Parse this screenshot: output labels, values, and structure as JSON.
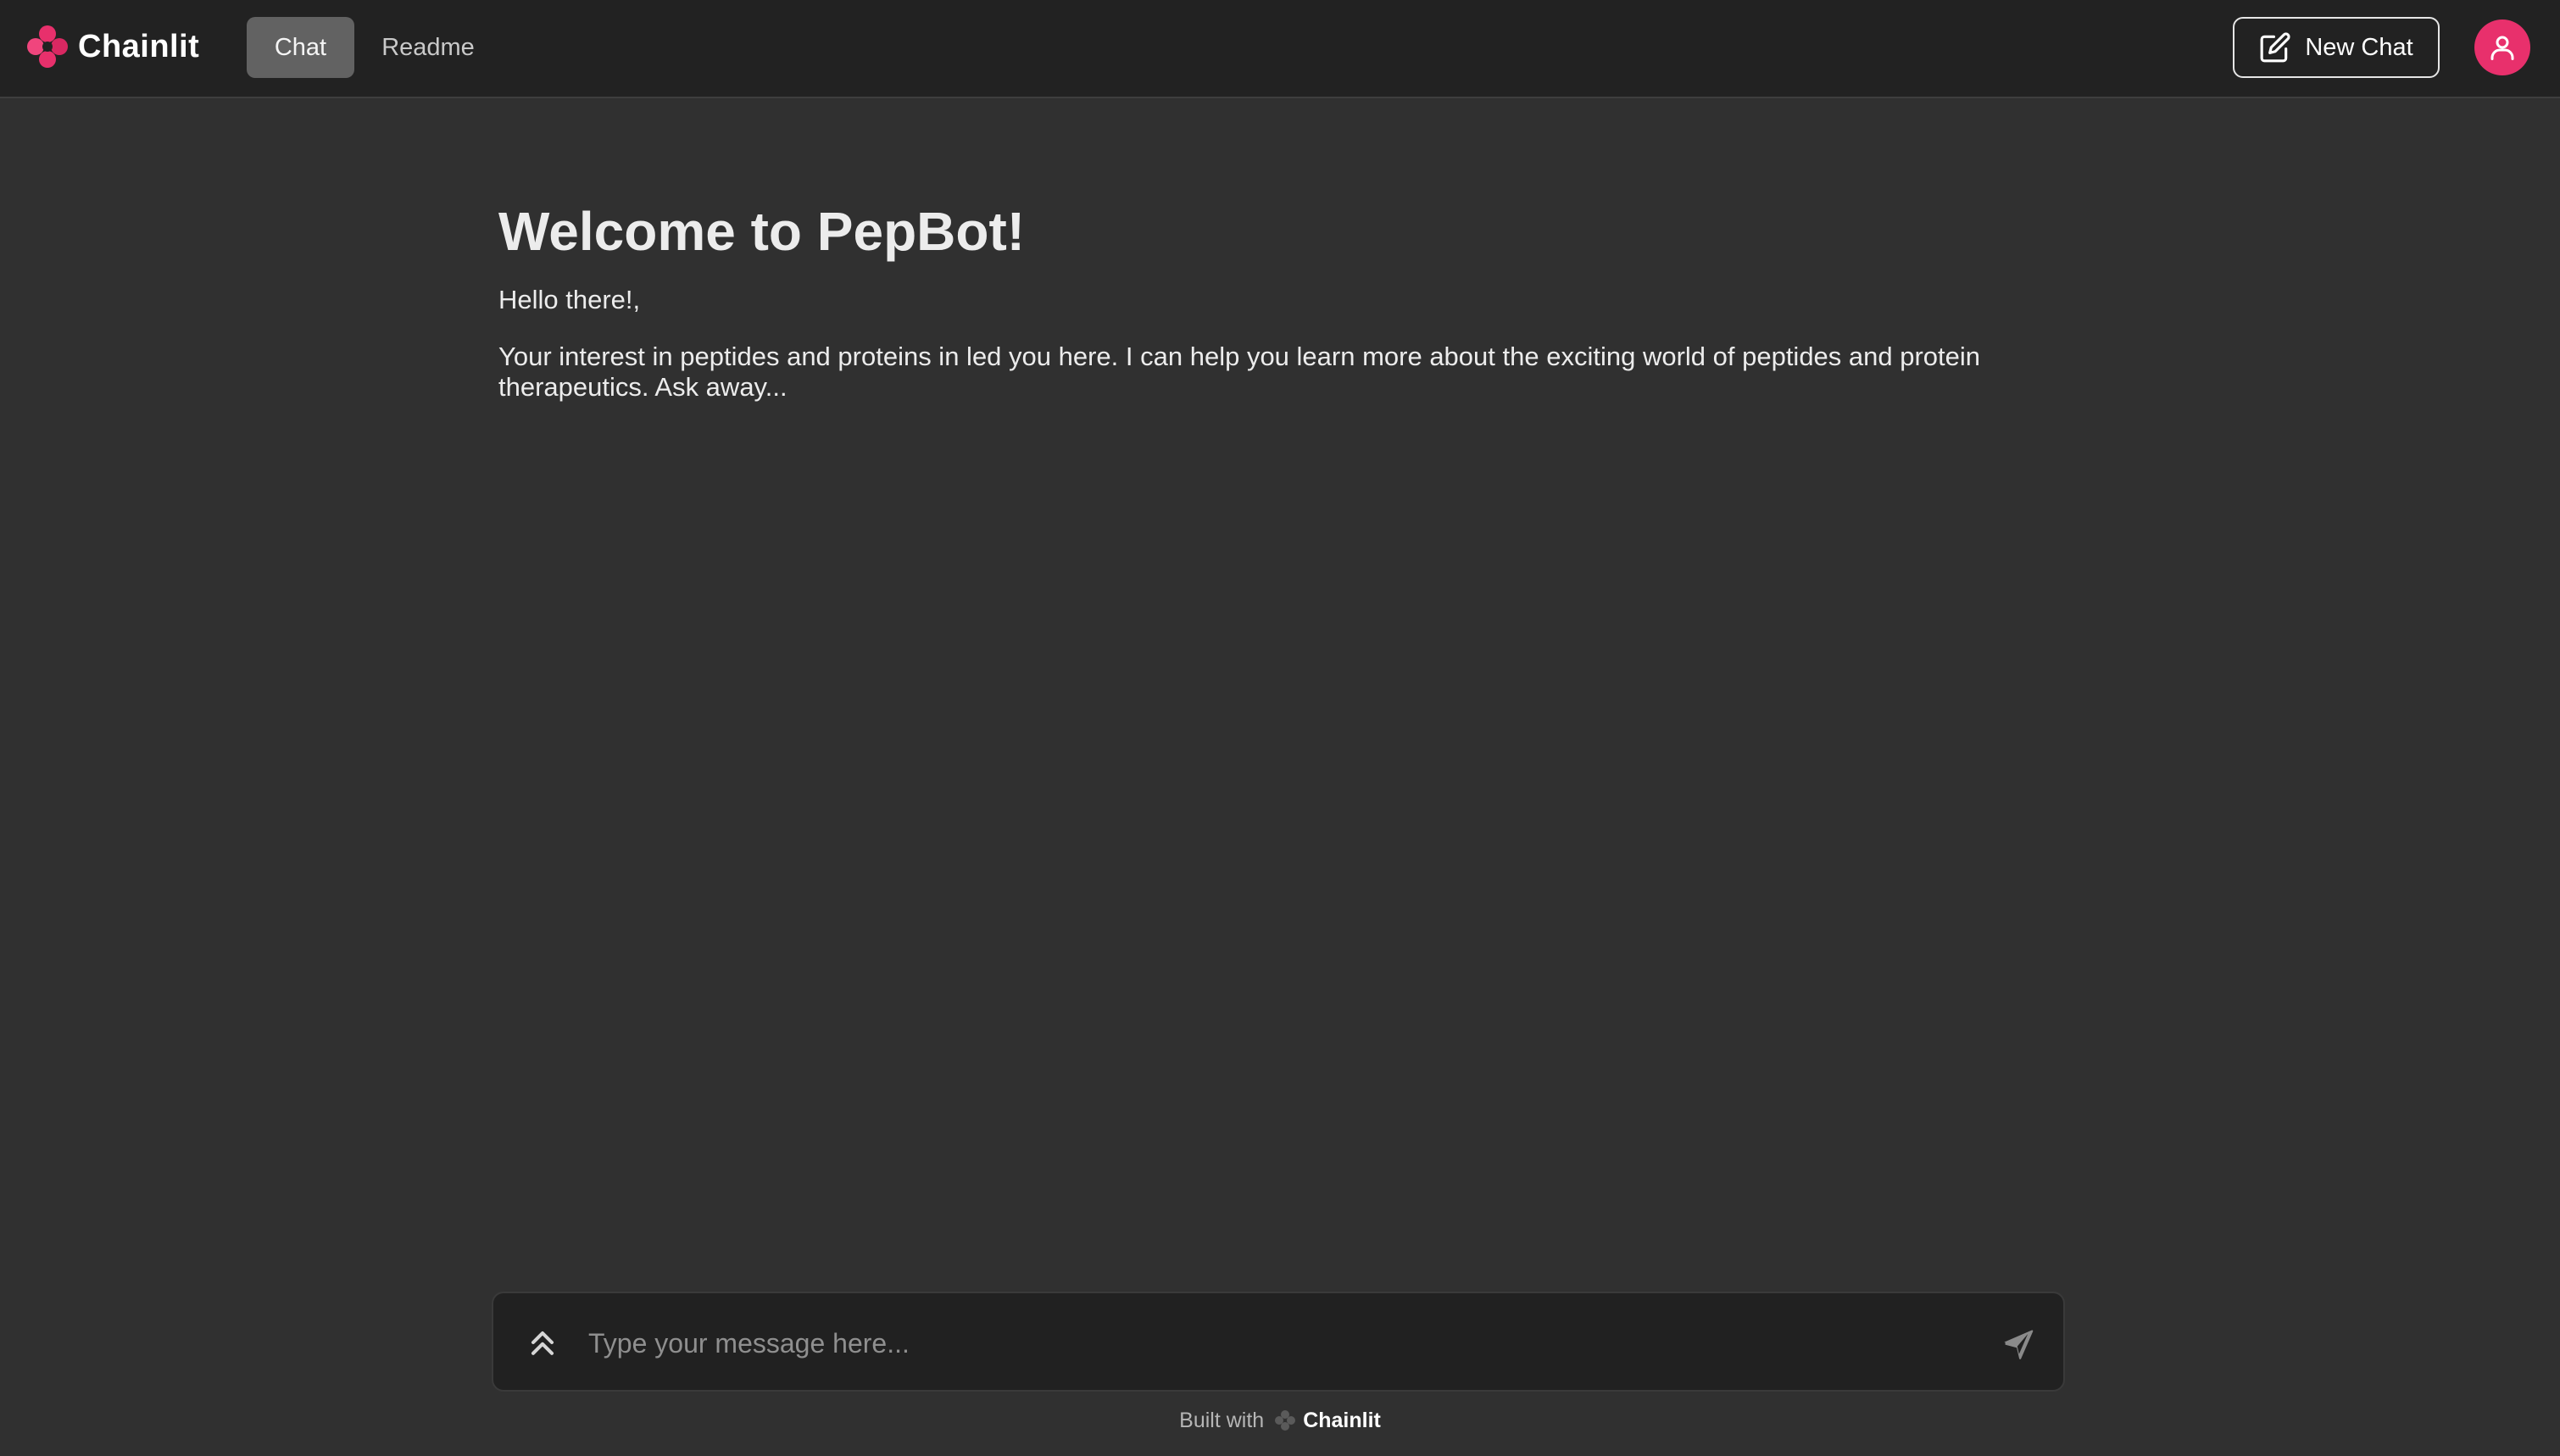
{
  "header": {
    "brand": "Chainlit",
    "tabs": [
      {
        "label": "Chat",
        "active": true
      },
      {
        "label": "Readme",
        "active": false
      }
    ],
    "new_chat_label": "New Chat",
    "avatar_icon": "user-icon"
  },
  "welcome": {
    "title": "Welcome to PepBot!",
    "greeting": "Hello there!,",
    "body": "Your interest in peptides and proteins in led you here. I can help you learn more about the exciting world of peptides and protein therapeutics. Ask away..."
  },
  "composer": {
    "placeholder": "Type your message here...",
    "value": "",
    "settings_icon": "chevrons-up-icon",
    "send_icon": "send-icon"
  },
  "footer": {
    "built_with": "Built with",
    "brand": "Chainlit"
  },
  "colors": {
    "accent": "#e8306c",
    "background": "#303030",
    "header_bg": "#222222",
    "composer_bg": "#212121"
  }
}
